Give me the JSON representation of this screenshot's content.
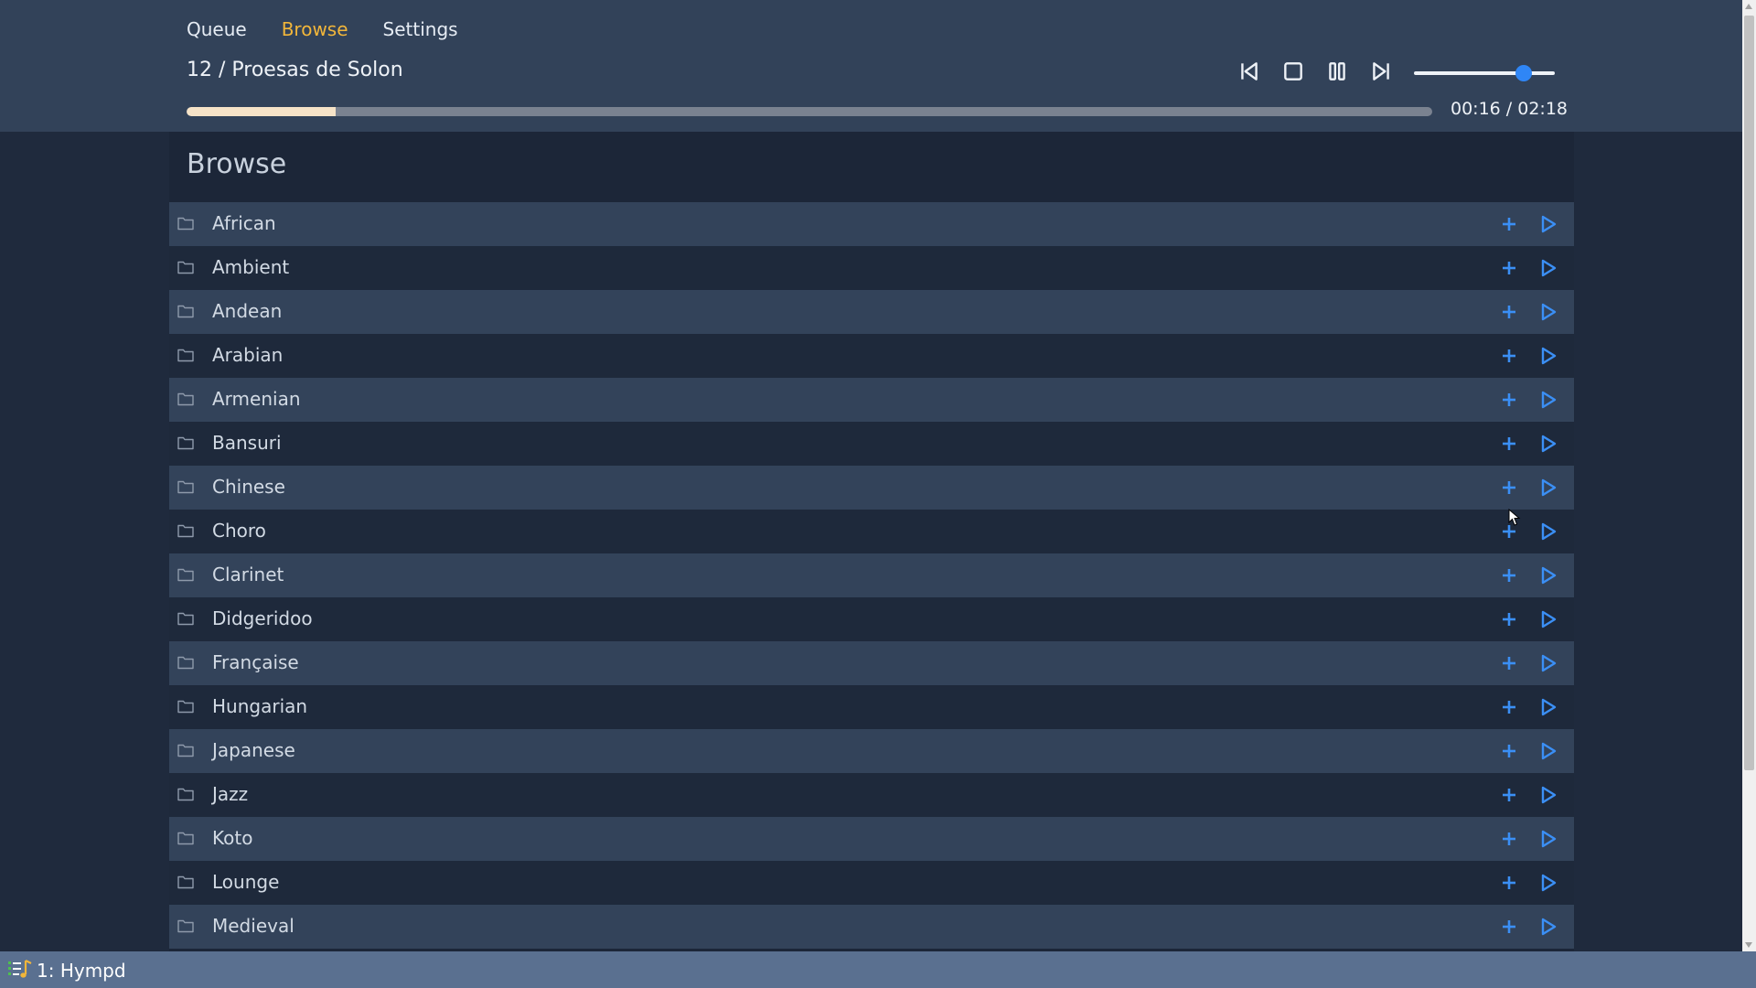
{
  "nav": {
    "queue": "Queue",
    "browse": "Browse",
    "settings": "Settings",
    "active": "browse"
  },
  "player": {
    "now_playing": "12 / Proesas de Solon",
    "time": "00:16 / 02:18",
    "progress_fraction": 0.12,
    "volume_fraction": 0.78,
    "buttons": [
      "previous-icon",
      "stop-icon",
      "pause-icon",
      "next-icon"
    ]
  },
  "browse": {
    "title": "Browse",
    "items": [
      {
        "label": "African"
      },
      {
        "label": "Ambient"
      },
      {
        "label": "Andean"
      },
      {
        "label": "Arabian"
      },
      {
        "label": "Armenian"
      },
      {
        "label": "Bansuri"
      },
      {
        "label": "Chinese"
      },
      {
        "label": "Choro"
      },
      {
        "label": "Clarinet"
      },
      {
        "label": "Didgeridoo"
      },
      {
        "label": "Française"
      },
      {
        "label": "Hungarian"
      },
      {
        "label": "Japanese"
      },
      {
        "label": "Jazz"
      },
      {
        "label": "Koto"
      },
      {
        "label": "Lounge"
      },
      {
        "label": "Medieval"
      }
    ]
  },
  "taskbar": {
    "app_label": "1: Hympd",
    "icon": "music-queue-icon"
  },
  "colors": {
    "header_bg": "#324259",
    "accent": "#f2b63a",
    "action_blue": "#3b8ff5",
    "row_alt": "#33435a",
    "row_base": "#1e293b"
  }
}
